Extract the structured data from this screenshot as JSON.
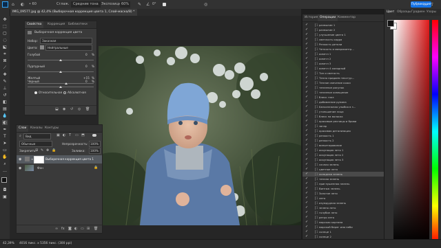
{
  "topbar": {
    "smooth_label": "Сглаж.",
    "smooth_value": "Средние тона",
    "exposure_label": "Экспозиция:",
    "exposure_value": "60%",
    "angle_value": "0°",
    "publish_label": "Публикация"
  },
  "document": {
    "tab_title": "IMG_09577.jpg @ 42,4% (Выборочная коррекция цвета 1, Слой-маска/8) *"
  },
  "properties": {
    "tabs": [
      "Свойства",
      "Коррекция",
      "Библиотеки"
    ],
    "title": "Выборочная коррекция цвета",
    "preset_label": "Набор:",
    "preset_value": "Заказная",
    "colors_label": "Цвета:",
    "colors_value": "Нейтральные",
    "sliders": [
      {
        "label": "Голубой",
        "value": "0",
        "unit": "%",
        "level": 0.5
      },
      {
        "label": "Пурпурный",
        "value": "0",
        "unit": "%",
        "level": 0.5
      },
      {
        "label": "Желтый",
        "value": "+15",
        "unit": "%",
        "level": 0.58
      },
      {
        "label": "Черный",
        "value": "0",
        "unit": "%",
        "level": 0.5
      }
    ],
    "method_relative": "Относительная",
    "method_absolute": "Абсолютная"
  },
  "layers": {
    "tabs": [
      "Слои",
      "Каналы",
      "Контуры"
    ],
    "filter_label": "Вид",
    "blend_mode": "Обычные",
    "opacity_label": "Непрозрачность:",
    "opacity_value": "100%",
    "lock_label": "Закрепить:",
    "fill_label": "Заливка:",
    "fill_value": "100%",
    "items": [
      {
        "name": "Выборочная коррекция цвета 1"
      },
      {
        "name": "Фон"
      }
    ]
  },
  "history": {
    "tabs": [
      "История",
      "Операции",
      "Комментар"
    ],
    "items": [
      {
        "num": "1",
        "name": "размытие 1"
      },
      {
        "num": "1",
        "name": "размытие 2"
      },
      {
        "num": "1",
        "name": "улучшение цвета 1"
      },
      {
        "num": "1",
        "name": "светлость кадра"
      },
      {
        "num": "1",
        "name": "Резкость детали"
      },
      {
        "num": "1",
        "name": "Четкость и микроконтр..."
      },
      {
        "num": "1",
        "name": "осветл 1"
      },
      {
        "num": "1",
        "name": "осветл 2"
      },
      {
        "num": "1",
        "name": "осветл 3"
      },
      {
        "num": "1",
        "name": "осветл 4 холодный"
      },
      {
        "num": "1",
        "name": "Тон и светость"
      },
      {
        "num": "1",
        "name": "Тепло придаем текстур..."
      },
      {
        "num": "1",
        "name": "Теплое свечение кожи"
      },
      {
        "num": "1",
        "name": "тепленое рисунок"
      },
      {
        "num": "1",
        "name": "тепленое освещение"
      },
      {
        "num": "1",
        "name": "блеск глаз"
      },
      {
        "num": "1",
        "name": "добавление румяна"
      },
      {
        "num": "1",
        "name": "Белоснежная улыбка в з..."
      },
      {
        "num": "1",
        "name": "утоньшение лица"
      },
      {
        "num": "1",
        "name": "блеск на волосах"
      },
      {
        "num": "1",
        "name": "красивые ресницы и брови"
      },
      {
        "num": "1",
        "name": "загар"
      },
      {
        "num": "1",
        "name": "красивая детализация"
      },
      {
        "num": "1",
        "name": "резкость 1"
      },
      {
        "num": "1",
        "name": "резкость 2"
      },
      {
        "num": "1",
        "name": "виньетирование"
      },
      {
        "num": "1",
        "name": "оккупация лето 1"
      },
      {
        "num": "1",
        "name": "оккупация лето 2"
      },
      {
        "num": "1",
        "name": "оккупация лето 3"
      },
      {
        "num": "1",
        "name": "сочная зелень"
      },
      {
        "num": "1",
        "name": "цветное лето"
      },
      {
        "num": "1",
        "name": "холодная зелень"
      },
      {
        "num": "1",
        "name": "теплая зелень"
      },
      {
        "num": "1",
        "name": "приглушенная зелень"
      },
      {
        "num": "1",
        "name": "Винтаж зелень"
      },
      {
        "num": "1",
        "name": "Золотое лето"
      },
      {
        "num": "1",
        "name": "лето"
      },
      {
        "num": "1",
        "name": "изумрудная зелень"
      },
      {
        "num": "1",
        "name": "зелено лето"
      },
      {
        "num": "1",
        "name": "голубое лето"
      },
      {
        "num": "1",
        "name": "ретро лето"
      },
      {
        "num": "1",
        "name": "морская картина"
      },
      {
        "num": "1",
        "name": "морской берег или небо"
      },
      {
        "num": "1",
        "name": "солнце 1"
      },
      {
        "num": "1",
        "name": "солнце 2"
      }
    ]
  },
  "color": {
    "tabs": [
      "Цвет",
      "Образцы",
      "Градиен",
      "Узоры"
    ],
    "foreground": "#111111",
    "background": "#ffffff",
    "hue": "#e01a1a"
  },
  "status": {
    "zoom": "42,39%",
    "doc_info": "4016 пикс. x 5356 пикс. (300 ppi)"
  }
}
